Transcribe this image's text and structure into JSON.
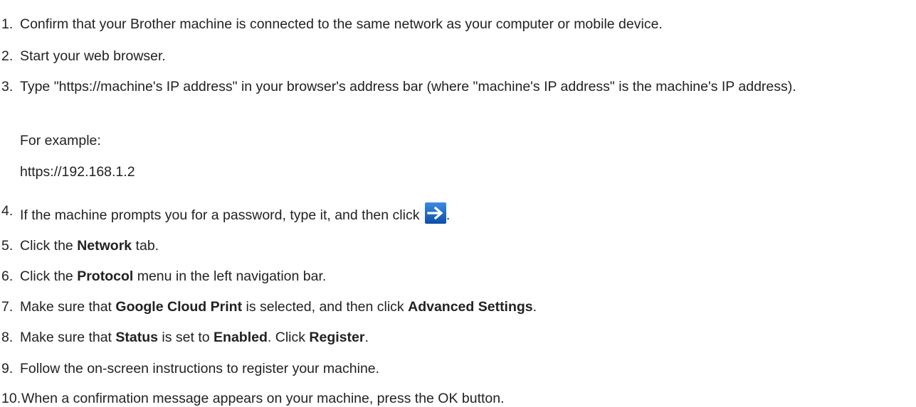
{
  "steps": [
    {
      "number": "1.",
      "text": "Confirm that your Brother machine is connected to the same network as your computer or mobile device."
    },
    {
      "number": "2.",
      "text": "Start your web browser."
    },
    {
      "number": "3.",
      "text": "Type \"https://machine's IP address\" in your browser's address bar (where \"machine's IP address\" is the machine's IP address).",
      "example_label": "For example:",
      "example_value": "https://192.168.1.2"
    },
    {
      "number": "4.",
      "text_before": "If the machine prompts you for a password, type it, and then click ",
      "text_after": ".",
      "icon": "arrow-right-icon",
      "icon_color": "#1565c0"
    },
    {
      "number": "5.",
      "parts": [
        "Click the ",
        "Network",
        " tab."
      ]
    },
    {
      "number": "6.",
      "parts": [
        "Click the ",
        "Protocol",
        " menu in the left navigation bar."
      ]
    },
    {
      "number": "7.",
      "parts": [
        "Make sure that ",
        "Google Cloud Print",
        " is selected, and then click ",
        "Advanced Settings",
        "."
      ]
    },
    {
      "number": "8.",
      "parts": [
        "Make sure that ",
        "Status",
        " is set to ",
        "Enabled",
        ". Click ",
        "Register",
        "."
      ]
    },
    {
      "number": "9.",
      "text": "Follow the on-screen instructions to register your machine."
    },
    {
      "number": "10.",
      "text": "When a confirmation message appears on your machine, press the OK button."
    }
  ]
}
